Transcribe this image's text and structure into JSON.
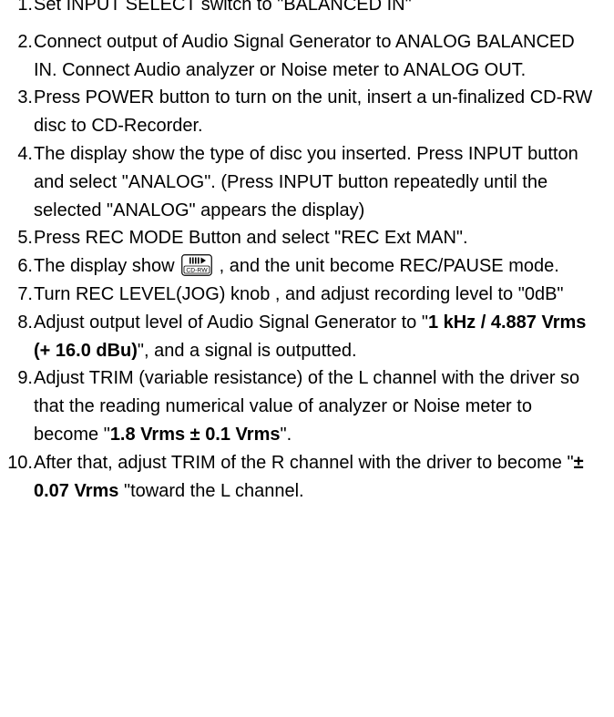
{
  "steps": [
    {
      "num": "1.",
      "parts": [
        {
          "t": "Set INPUT SELECT switch to \"BALANCED IN\""
        }
      ]
    },
    {
      "num": "2.",
      "parts": [
        {
          "t": "Connect output of Audio Signal Generator to ANALOG BALANCED IN.  Connect Audio analyzer or Noise meter to ANALOG OUT."
        }
      ]
    },
    {
      "num": "3.",
      "parts": [
        {
          "t": "Press POWER button to turn on the unit, insert a un-finalized CD-RW disc to CD-Recorder."
        }
      ]
    },
    {
      "num": "4.",
      "parts": [
        {
          "t": "The display show the type of disc you inserted.  Press INPUT button and select \"ANALOG\". (Press INPUT button repeatedly until the selected \"ANALOG\" appears the display)"
        }
      ]
    },
    {
      "num": "5.",
      "parts": [
        {
          "t": "Press REC MODE Button and select \"REC Ext MAN\"."
        }
      ]
    },
    {
      "num": "6.",
      "parts": [
        {
          "t": "The display show "
        },
        {
          "icon": "cdrw-rec-pause-icon"
        },
        {
          "t": " , and the unit become REC/PAUSE mode."
        }
      ]
    },
    {
      "num": "7.",
      "parts": [
        {
          "t": "Turn REC LEVEL(JOG) knob , and adjust recording level to \"0dB\""
        }
      ]
    },
    {
      "num": "8.",
      "parts": [
        {
          "t": "Adjust output level of Audio Signal Generator to \""
        },
        {
          "b": "1 kHz / 4.887 Vrms (+ 16.0 dBu)"
        },
        {
          "t": "\", and a signal is outputted."
        }
      ]
    },
    {
      "num": "9.",
      "parts": [
        {
          "t": "Adjust TRIM (variable resistance) of the L channel with the driver so that the reading numerical value of  analyzer or Noise meter to become \""
        },
        {
          "b": "1.8 Vrms ± 0.1 Vrms"
        },
        {
          "t": "\"."
        }
      ]
    },
    {
      "num": "10.",
      "parts": [
        {
          "t": "After that, adjust TRIM of the R channel with the driver to become \""
        },
        {
          "b": "± 0.07 Vrms"
        },
        {
          "t": " \"toward the L channel."
        }
      ]
    }
  ],
  "icon_label": "CD-RW"
}
